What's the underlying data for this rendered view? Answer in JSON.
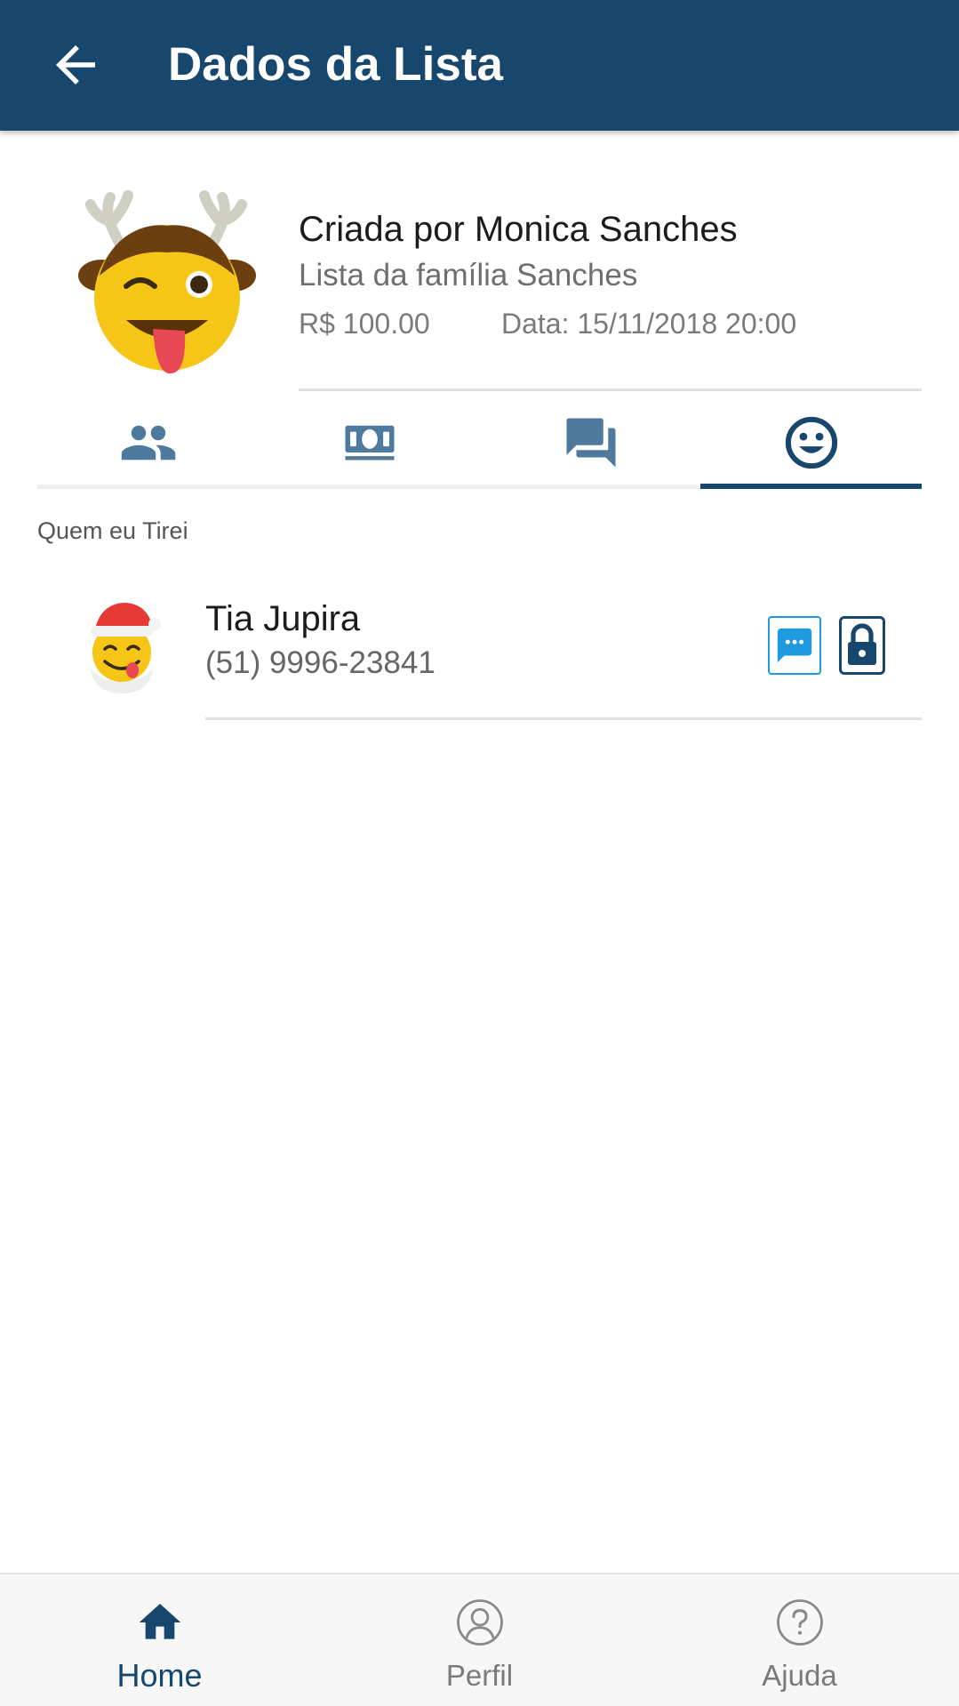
{
  "app_bar": {
    "title": "Dados da Lista",
    "back_icon": "arrow-left-icon"
  },
  "list_header": {
    "avatar": "reindeer-emoji-avatar",
    "creator": "Criada por Monica Sanches",
    "list_name": "Lista da família Sanches",
    "price": "R$ 100.00",
    "date": "Data: 15/11/2018 20:00"
  },
  "tabs": [
    {
      "icon": "people-icon",
      "active": false
    },
    {
      "icon": "money-icon",
      "active": false
    },
    {
      "icon": "chat-bubbles-icon",
      "active": false
    },
    {
      "icon": "smiley-face-icon",
      "active": true
    }
  ],
  "section": {
    "label": "Quem eu Tirei"
  },
  "drawn_person": {
    "avatar": "santa-emoji-avatar",
    "name": "Tia Jupira",
    "phone": "(51) 9996-23841",
    "actions": [
      "chat-icon",
      "lock-icon"
    ]
  },
  "bottom_nav": [
    {
      "label": "Home",
      "icon": "home-icon",
      "active": true
    },
    {
      "label": "Perfil",
      "icon": "profile-icon",
      "active": false
    },
    {
      "label": "Ajuda",
      "icon": "help-icon",
      "active": false
    }
  ],
  "colors": {
    "primary": "#18476e",
    "tab_icon": "#4e7a9e",
    "chat_accent": "#1e9be0",
    "background": "#ffffff"
  }
}
